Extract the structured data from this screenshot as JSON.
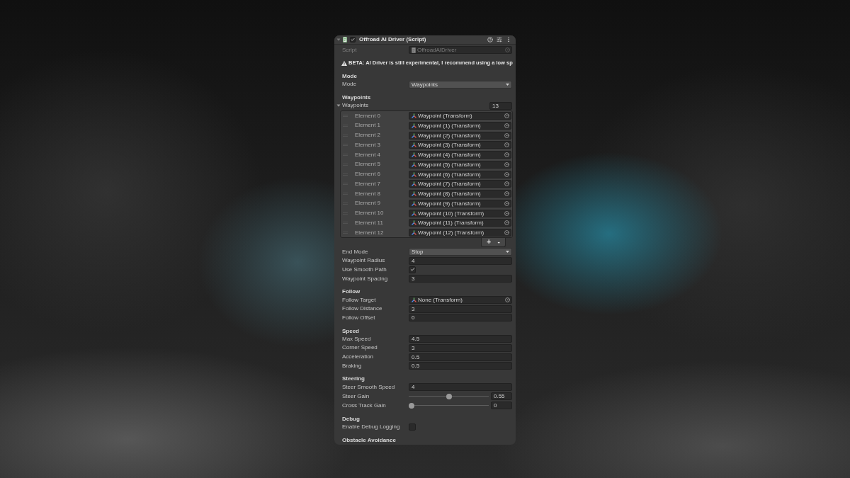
{
  "component": {
    "title": "Offroad AI Driver (Script)",
    "expanded": true,
    "enabled": true
  },
  "script_field": {
    "label": "Script",
    "value": "OffroadAIDriver",
    "disabled": true
  },
  "warning": "BETA: AI Driver is still experimental, I recommend using a low sp",
  "sections": [
    {
      "heading": "Mode",
      "fields": [
        {
          "kind": "dropdown",
          "label": "Mode",
          "value": "Waypoints"
        }
      ]
    },
    {
      "heading": "Waypoints",
      "fields": [
        {
          "kind": "list",
          "label": "Waypoints",
          "expanded": true,
          "count": "13",
          "elements": [
            {
              "label": "Element 0",
              "value": "Waypoint (Transform)"
            },
            {
              "label": "Element 1",
              "value": "Waypoint (1) (Transform)"
            },
            {
              "label": "Element 2",
              "value": "Waypoint (2) (Transform)"
            },
            {
              "label": "Element 3",
              "value": "Waypoint (3) (Transform)"
            },
            {
              "label": "Element 4",
              "value": "Waypoint (4) (Transform)"
            },
            {
              "label": "Element 5",
              "value": "Waypoint (5) (Transform)"
            },
            {
              "label": "Element 6",
              "value": "Waypoint (6) (Transform)"
            },
            {
              "label": "Element 7",
              "value": "Waypoint (7) (Transform)"
            },
            {
              "label": "Element 8",
              "value": "Waypoint (8) (Transform)"
            },
            {
              "label": "Element 9",
              "value": "Waypoint (9) (Transform)"
            },
            {
              "label": "Element 10",
              "value": "Waypoint (10) (Transform)"
            },
            {
              "label": "Element 11",
              "value": "Waypoint (11) (Transform)"
            },
            {
              "label": "Element 12",
              "value": "Waypoint (12) (Transform)"
            }
          ],
          "buttons": [
            "+",
            "-"
          ]
        },
        {
          "kind": "dropdown",
          "label": "End Mode",
          "value": "Stop"
        },
        {
          "kind": "number",
          "label": "Waypoint Radius",
          "value": "4"
        },
        {
          "kind": "toggle",
          "label": "Use Smooth Path",
          "checked": true
        },
        {
          "kind": "number",
          "label": "Waypoint Spacing",
          "value": "3"
        }
      ]
    },
    {
      "heading": "Follow",
      "fields": [
        {
          "kind": "object",
          "label": "Follow Target",
          "value": "None (Transform)"
        },
        {
          "kind": "number",
          "label": "Follow Distance",
          "value": "3"
        },
        {
          "kind": "number",
          "label": "Follow Offset",
          "value": "0"
        }
      ]
    },
    {
      "heading": "Speed",
      "fields": [
        {
          "kind": "number",
          "label": "Max Speed",
          "value": "4.5"
        },
        {
          "kind": "number",
          "label": "Corner Speed",
          "value": "3"
        },
        {
          "kind": "number",
          "label": "Acceleration",
          "value": "0.5"
        },
        {
          "kind": "number",
          "label": "Braking",
          "value": "0.5"
        }
      ]
    },
    {
      "heading": "Steering",
      "fields": [
        {
          "kind": "number",
          "label": "Steer Smooth Speed",
          "value": "4"
        },
        {
          "kind": "slider",
          "label": "Steer Gain",
          "level": 0.5,
          "value": "0.55"
        },
        {
          "kind": "slider",
          "label": "Cross Track Gain",
          "level": 0,
          "value": "0"
        }
      ]
    },
    {
      "heading": "Debug",
      "fields": [
        {
          "kind": "toggle",
          "label": "Enable Debug Logging",
          "checked": false
        }
      ]
    },
    {
      "heading": "Obstacle Avoidance"
    }
  ]
}
